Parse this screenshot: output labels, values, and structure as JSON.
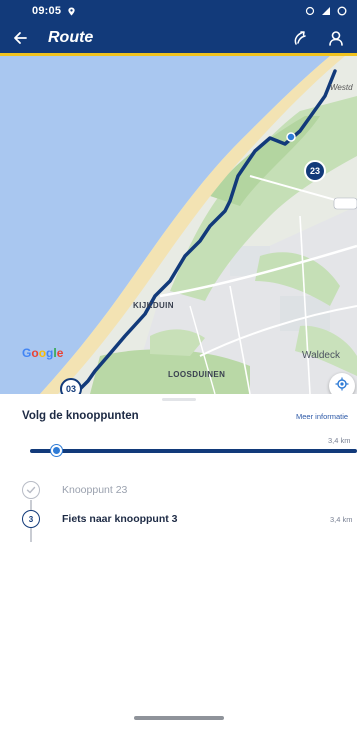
{
  "status_bar": {
    "time": "09:05",
    "icons": [
      "location-pin-icon",
      "wifi-off-icon",
      "signal-icon",
      "battery-icon"
    ]
  },
  "app_bar": {
    "title": "Route",
    "back_icon": "arrow-left-icon",
    "action_icons": [
      "share-route-icon",
      "person-icon"
    ],
    "background": "#123a7a",
    "accent": "#f0c21e"
  },
  "map": {
    "place_labels": [
      "KIJKDUIN",
      "LOOSDUINEN",
      "Waldeck",
      "Westd"
    ],
    "node_start": "23",
    "node_end": "03",
    "provider": "Google",
    "route_color": "#123a7a"
  },
  "sheet": {
    "title": "Volg de knooppunten",
    "more_info": "Meer informatie",
    "total_distance": "3,4 km",
    "progress_fraction": 0.08,
    "steps": [
      {
        "badge": "",
        "label": "Knooppunt 23",
        "distance": "",
        "state": "done"
      },
      {
        "badge": "3",
        "label": "Fiets naar knooppunt 3",
        "distance": "3,4 km",
        "state": "current"
      }
    ]
  }
}
